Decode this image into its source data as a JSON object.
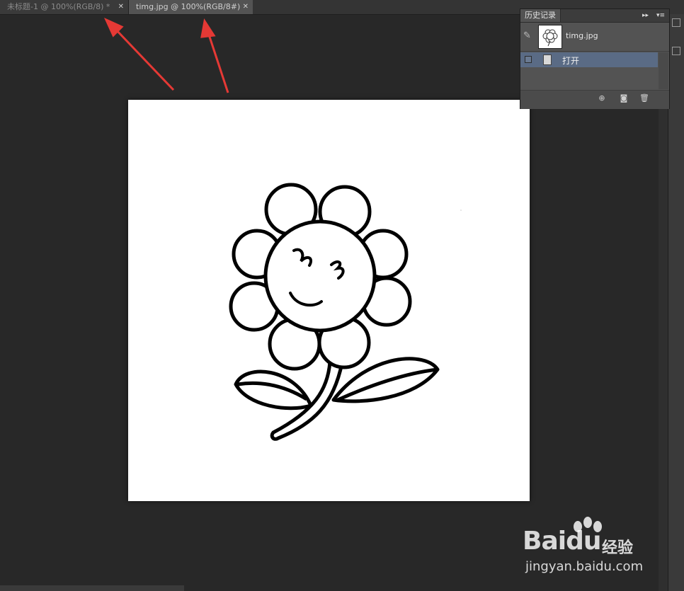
{
  "tabs": [
    {
      "label": "未标题-1 @ 100%(RGB/8) *",
      "active": false
    },
    {
      "label": "timg.jpg @ 100%(RGB/8#)",
      "active": true
    }
  ],
  "history_panel": {
    "title": "历史记录",
    "snapshot_label": "timg.jpg",
    "items": [
      {
        "label": "打开",
        "selected": true
      }
    ]
  },
  "watermark": {
    "logo": "Bai",
    "logo_tail": "du",
    "cn": "经验",
    "url": "jingyan.baidu.com"
  },
  "colors": {
    "workspace": "#282828",
    "selection": "#5a6b85",
    "arrow": "#e53935"
  }
}
